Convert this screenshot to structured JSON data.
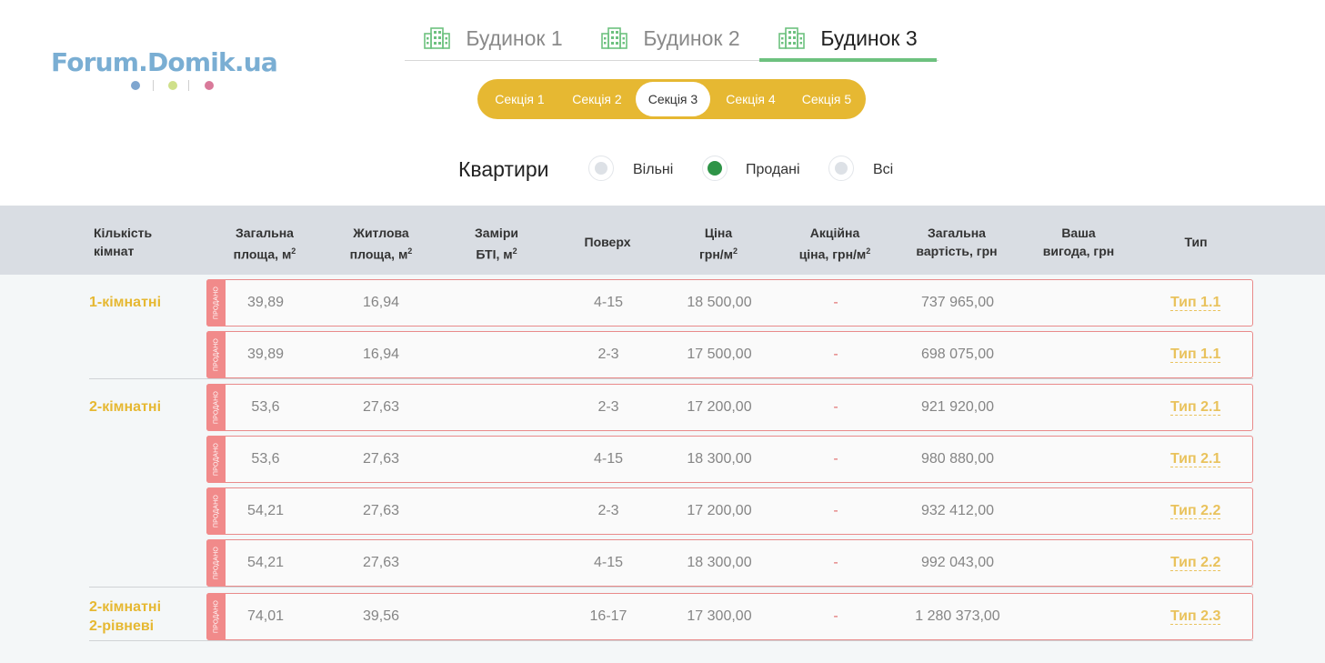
{
  "logo": {
    "text": "Forum.Domik.ua",
    "dot_colors": [
      "#7fa6cf",
      "#cfe08a",
      "#d97a9a"
    ]
  },
  "houses": [
    {
      "label": "Будинок 1",
      "active": false
    },
    {
      "label": "Будинок 2",
      "active": false
    },
    {
      "label": "Будинок 3",
      "active": true
    }
  ],
  "sections": [
    {
      "label": "Секція 1",
      "active": false
    },
    {
      "label": "Секція 2",
      "active": false
    },
    {
      "label": "Секція 3",
      "active": true
    },
    {
      "label": "Секція 4",
      "active": false
    },
    {
      "label": "Секція 5",
      "active": false
    }
  ],
  "filter": {
    "title": "Квартири",
    "options": [
      {
        "label": "Вільні",
        "checked": false
      },
      {
        "label": "Продані",
        "checked": true
      },
      {
        "label": "Всі",
        "checked": false
      }
    ]
  },
  "columns": {
    "rooms_1": "Кількість",
    "rooms_2": "кімнат",
    "total_area_1": "Загальна",
    "total_area_2": "площа, м",
    "living_area_1": "Житлова",
    "living_area_2": "площа, м",
    "bti_1": "Заміри",
    "bti_2": "БТІ, м",
    "floor": "Поверх",
    "price_1": "Ціна",
    "price_2": "грн/м",
    "promo_1": "Акційна",
    "promo_2": "ціна, грн/м",
    "total_cost_1": "Загальна",
    "total_cost_2": "вартість, грн",
    "benefit_1": "Ваша",
    "benefit_2": "вигода, грн",
    "type": "Тип",
    "sup": "2"
  },
  "sold_label": "ПРОДАНО",
  "groups": [
    {
      "label_1": "1-кімнатні",
      "label_2": ""
    },
    {
      "label_1": "2-кімнатні",
      "label_2": ""
    },
    {
      "label_1": "2-кімнатні",
      "label_2": "2-рівневі"
    }
  ],
  "rows": [
    {
      "total_area": "39,89",
      "living_area": "16,94",
      "floor": "4-15",
      "price": "18 500,00",
      "promo": "-",
      "total_cost": "737 965,00",
      "type": "Тип 1.1"
    },
    {
      "total_area": "39,89",
      "living_area": "16,94",
      "floor": "2-3",
      "price": "17 500,00",
      "promo": "-",
      "total_cost": "698 075,00",
      "type": "Тип 1.1"
    },
    {
      "total_area": "53,6",
      "living_area": "27,63",
      "floor": "2-3",
      "price": "17 200,00",
      "promo": "-",
      "total_cost": "921 920,00",
      "type": "Тип 2.1"
    },
    {
      "total_area": "53,6",
      "living_area": "27,63",
      "floor": "4-15",
      "price": "18 300,00",
      "promo": "-",
      "total_cost": "980 880,00",
      "type": "Тип 2.1"
    },
    {
      "total_area": "54,21",
      "living_area": "27,63",
      "floor": "2-3",
      "price": "17 200,00",
      "promo": "-",
      "total_cost": "932 412,00",
      "type": "Тип 2.2"
    },
    {
      "total_area": "54,21",
      "living_area": "27,63",
      "floor": "4-15",
      "price": "18 300,00",
      "promo": "-",
      "total_cost": "992 043,00",
      "type": "Тип 2.2"
    },
    {
      "total_area": "74,01",
      "living_area": "39,56",
      "floor": "16-17",
      "price": "17 300,00",
      "promo": "-",
      "total_cost": "1 280 373,00",
      "type": "Тип 2.3"
    }
  ]
}
